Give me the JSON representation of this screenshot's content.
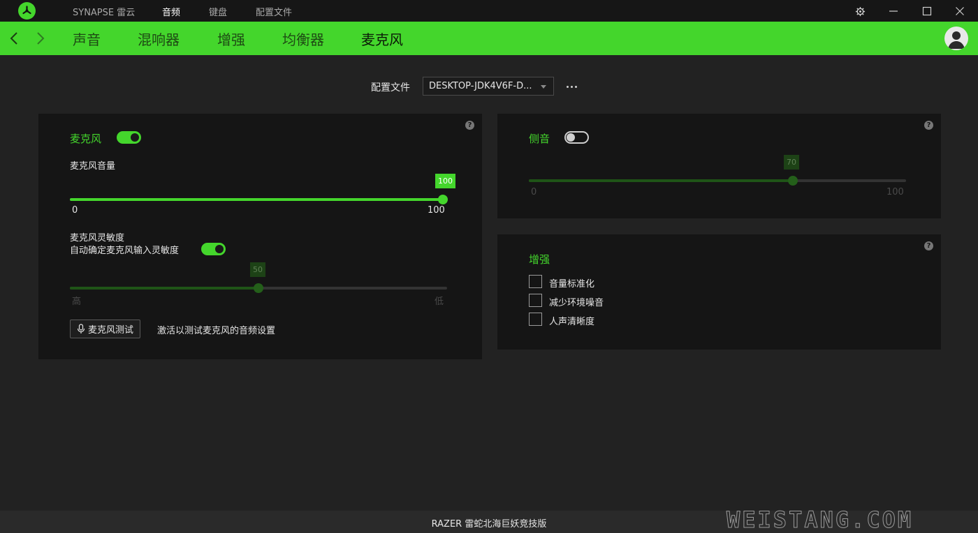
{
  "titlebar": {
    "app_name": "SYNAPSE 雷云",
    "tabs": [
      {
        "label": "音频",
        "active": true
      },
      {
        "label": "键盘",
        "active": false
      },
      {
        "label": "配置文件",
        "active": false
      }
    ],
    "controls": [
      "gear-icon",
      "minimize-icon",
      "maximize-icon",
      "close-icon"
    ]
  },
  "nav": {
    "tabs": [
      {
        "label": "声音",
        "active": false
      },
      {
        "label": "混响器",
        "active": false
      },
      {
        "label": "增强",
        "active": false
      },
      {
        "label": "均衡器",
        "active": false
      },
      {
        "label": "麦克风",
        "active": true
      }
    ]
  },
  "profile": {
    "label": "配置文件",
    "selected": "DESKTOP-JDK4V6F-D..."
  },
  "mic_card": {
    "title": "麦克风",
    "enabled": true,
    "volume": {
      "label": "麦克风音量",
      "value": 100,
      "value_text": "100",
      "min_label": "0",
      "max_label": "100",
      "min": 0,
      "max": 100
    },
    "sensitivity": {
      "label": "麦克风灵敏度",
      "auto_label": "自动确定麦克风输入灵敏度",
      "auto_enabled": true,
      "value": 50,
      "value_text": "50",
      "min_label": "高",
      "max_label": "低",
      "min": 0,
      "max": 100,
      "disabled": true
    },
    "test_button": "麦克风测试",
    "test_hint": "激活以测试麦克风的音频设置"
  },
  "sidetone_card": {
    "title": "侧音",
    "enabled": false,
    "value": 70,
    "value_text": "70",
    "min_label": "0",
    "max_label": "100",
    "min": 0,
    "max": 100
  },
  "enhance_card": {
    "title": "增强",
    "options": [
      {
        "label": "音量标准化",
        "checked": false
      },
      {
        "label": "减少环境噪音",
        "checked": false
      },
      {
        "label": "人声清晰度",
        "checked": false
      }
    ]
  },
  "footer": {
    "device": "RAZER 雷蛇北海巨妖竞技版"
  },
  "watermark": "WEISTANG.COM",
  "colors": {
    "accent": "#44d62c",
    "background": "#222222",
    "card": "#151515",
    "titlebar": "#161616"
  }
}
